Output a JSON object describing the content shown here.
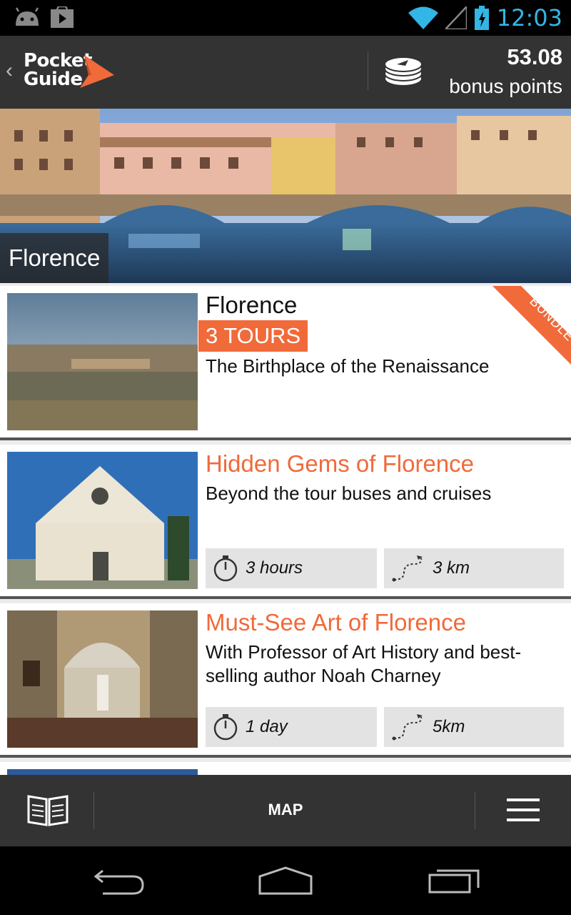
{
  "status_bar": {
    "time": "12:03"
  },
  "header": {
    "logo_line1": "Pocket",
    "logo_line2": "Guide",
    "points_value": "53.08",
    "points_label": "bonus points"
  },
  "hero": {
    "city": "Florence"
  },
  "cards": [
    {
      "title": "Florence",
      "badge": "3 TOURS",
      "ribbon": "BUNDLE",
      "subtitle": "The Birthplace of the Renaissance"
    },
    {
      "title": "Hidden Gems of Florence",
      "subtitle": "Beyond the tour buses and cruises",
      "duration": "3 hours",
      "distance": "3 km"
    },
    {
      "title": "Must-See Art of Florence",
      "subtitle": "With Professor of Art History and best-selling author Noah Charney",
      "duration": "1 day",
      "distance": "5km"
    }
  ],
  "bottom_bar": {
    "map_label": "MAP"
  },
  "colors": {
    "accent": "#f06a3a",
    "header": "#333333",
    "status_time": "#33b5e5"
  },
  "icons": [
    "android-icon",
    "play-store-icon",
    "wifi-icon",
    "signal-icon",
    "battery-icon",
    "coins-icon",
    "stopwatch-icon",
    "route-icon",
    "book-icon",
    "menu-icon",
    "back-icon",
    "home-icon",
    "recents-icon"
  ]
}
